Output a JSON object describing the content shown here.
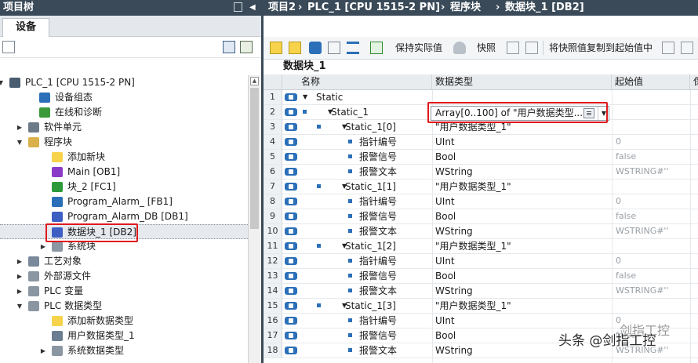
{
  "left_pane": {
    "title": "项目树",
    "tab_device": "设备",
    "tree": [
      {
        "label": "PLC_1 [CPU 1515-2 PN]",
        "icon": "plc-icon",
        "expanded": true
      },
      {
        "label": "设备组态",
        "icon": "device-config-icon"
      },
      {
        "label": "在线和诊断",
        "icon": "online-diagnostics-icon"
      },
      {
        "label": "软件单元",
        "icon": "software-units-icon",
        "expanded": false
      },
      {
        "label": "程序块",
        "icon": "folder-icon",
        "expanded": true
      },
      {
        "label": "添加新块",
        "icon": "add-block-icon"
      },
      {
        "label": "Main [OB1]",
        "icon": "ob-icon"
      },
      {
        "label": "块_2 [FC1]",
        "icon": "fc-icon"
      },
      {
        "label": "Program_Alarm_ [FB1]",
        "icon": "fb-icon"
      },
      {
        "label": "Program_Alarm_DB [DB1]",
        "icon": "db-icon"
      },
      {
        "label": "数据块_1 [DB2]",
        "icon": "db-icon",
        "selected": true
      },
      {
        "label": "系统块",
        "icon": "system-blocks-icon",
        "expanded": false
      },
      {
        "label": "工艺对象",
        "icon": "technology-objects-icon",
        "expanded": false
      },
      {
        "label": "外部源文件",
        "icon": "external-sources-icon",
        "expanded": false
      },
      {
        "label": "PLC 变量",
        "icon": "plc-tags-icon",
        "expanded": false
      },
      {
        "label": "PLC 数据类型",
        "icon": "plc-datatypes-icon",
        "expanded": true
      },
      {
        "label": "添加新数据类型",
        "icon": "add-datatype-icon"
      },
      {
        "label": "用户数据类型_1",
        "icon": "udt-icon"
      },
      {
        "label": "系统数据类型",
        "icon": "system-datatypes-icon",
        "expanded": false
      }
    ]
  },
  "breadcrumb": [
    "项目2",
    "PLC_1 [CPU 1515-2 PN]",
    "程序块",
    "数据块_1 [DB2]"
  ],
  "toolbar": {
    "keep_actual_values": "保持实际值",
    "snapshot": "快照",
    "copy_snapshot": "将快照值复制到起始值中"
  },
  "block_title": "数据块_1",
  "columns": {
    "name": "名称",
    "datatype": "数据类型",
    "start_value": "起始值",
    "retain": "保"
  },
  "rows": [
    {
      "n": "1",
      "level": 0,
      "exp": true,
      "name": "Static",
      "type": "",
      "start": ""
    },
    {
      "n": "2",
      "level": 1,
      "exp": true,
      "name": "Static_1",
      "type": "Array[0..100] of \"用户数据类型...",
      "start": "",
      "editing": true
    },
    {
      "n": "3",
      "level": 2,
      "exp": true,
      "name": "Static_1[0]",
      "type": "\"用户数据类型_1\"",
      "start": ""
    },
    {
      "n": "4",
      "level": 3,
      "exp": false,
      "name": "指针编号",
      "type": "UInt",
      "start": "0"
    },
    {
      "n": "5",
      "level": 3,
      "exp": false,
      "name": "报警信号",
      "type": "Bool",
      "start": "false"
    },
    {
      "n": "6",
      "level": 3,
      "exp": false,
      "name": "报警文本",
      "type": "WString",
      "start": "WSTRING#''"
    },
    {
      "n": "7",
      "level": 2,
      "exp": true,
      "name": "Static_1[1]",
      "type": "\"用户数据类型_1\"",
      "start": ""
    },
    {
      "n": "8",
      "level": 3,
      "exp": false,
      "name": "指针编号",
      "type": "UInt",
      "start": "0"
    },
    {
      "n": "9",
      "level": 3,
      "exp": false,
      "name": "报警信号",
      "type": "Bool",
      "start": "false"
    },
    {
      "n": "10",
      "level": 3,
      "exp": false,
      "name": "报警文本",
      "type": "WString",
      "start": "WSTRING#''"
    },
    {
      "n": "11",
      "level": 2,
      "exp": true,
      "name": "Static_1[2]",
      "type": "\"用户数据类型_1\"",
      "start": ""
    },
    {
      "n": "12",
      "level": 3,
      "exp": false,
      "name": "指针编号",
      "type": "UInt",
      "start": "0"
    },
    {
      "n": "13",
      "level": 3,
      "exp": false,
      "name": "报警信号",
      "type": "Bool",
      "start": "false"
    },
    {
      "n": "14",
      "level": 3,
      "exp": false,
      "name": "报警文本",
      "type": "WString",
      "start": "WSTRING#''"
    },
    {
      "n": "15",
      "level": 2,
      "exp": true,
      "name": "Static_1[3]",
      "type": "\"用户数据类型_1\"",
      "start": ""
    },
    {
      "n": "16",
      "level": 3,
      "exp": false,
      "name": "指针编号",
      "type": "UInt",
      "start": "0"
    },
    {
      "n": "17",
      "level": 3,
      "exp": false,
      "name": "报警信号",
      "type": "Bool",
      "start": "false"
    },
    {
      "n": "18",
      "level": 3,
      "exp": false,
      "name": "报警文本",
      "type": "WString",
      "start": "WSTRING#''"
    }
  ],
  "watermark": "头条 @剑指工控",
  "watermark_faint": "剑指工控",
  "colors": {
    "titlebar": "#3a4a58",
    "highlight_box": "#e0191c",
    "io_icon": "#2b6fb8"
  }
}
